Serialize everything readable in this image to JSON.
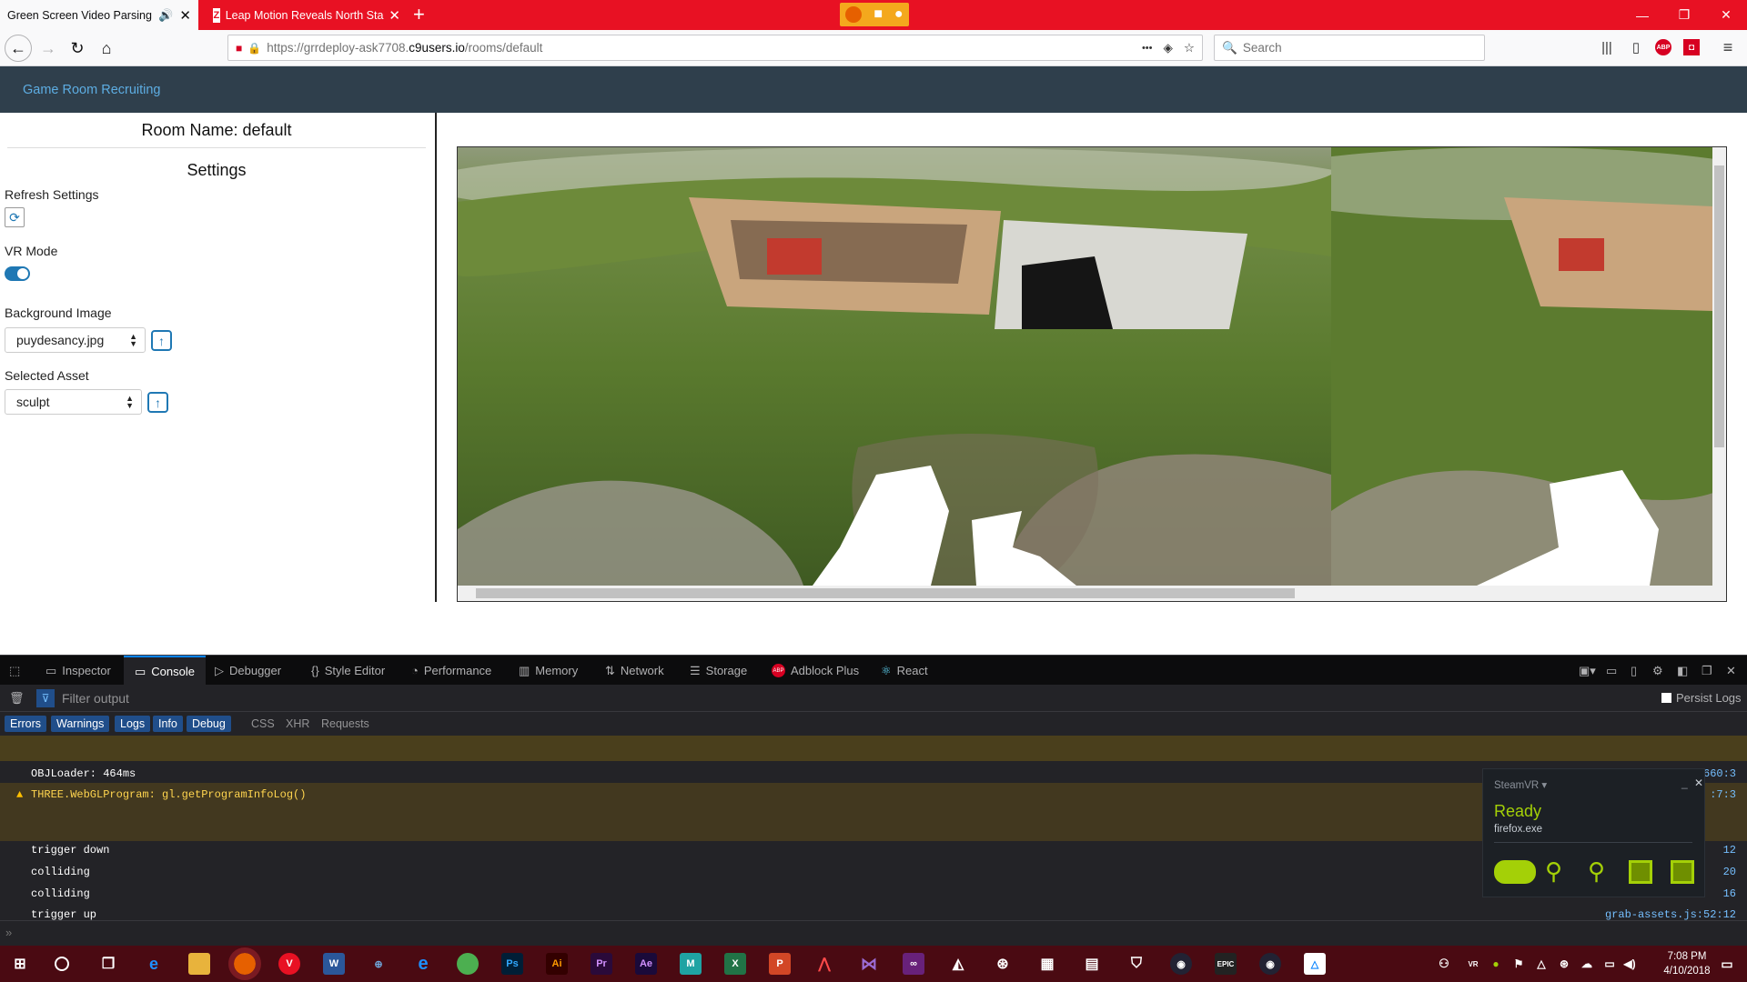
{
  "browser": {
    "tabs": [
      {
        "title": "Green Screen Video Parsing",
        "active": true
      },
      {
        "title": "Leap Motion Reveals North Sta",
        "active": false
      }
    ],
    "url_prefix": "https://grrdeploy-ask7708.",
    "url_domain": "c9users.io",
    "url_path": "/rooms/default",
    "search_placeholder": "Search",
    "new_tab": "+",
    "menu_dots": "•••"
  },
  "site": {
    "brand": "Game Room Recruiting"
  },
  "sidebar": {
    "room_title": "Room Name: default",
    "settings_heading": "Settings",
    "refresh_label": "Refresh Settings",
    "vr_label": "VR Mode",
    "vr_enabled": true,
    "bg_label": "Background Image",
    "bg_value": "puydesancy.jpg",
    "asset_label": "Selected Asset",
    "asset_value": "sculpt"
  },
  "devtools": {
    "tabs": [
      "Inspector",
      "Console",
      "Debugger",
      "Style Editor",
      "Performance",
      "Memory",
      "Network",
      "Storage",
      "Adblock Plus",
      "React"
    ],
    "active_tab": "Console",
    "filter_placeholder": "Filter output",
    "persist_logs": "Persist Logs",
    "categories_on": [
      "Errors",
      "Warnings",
      "Logs",
      "Info",
      "Debug"
    ],
    "categories_off": [
      "CSS",
      "XHR",
      "Requests"
    ],
    "messages": [
      {
        "text": "OBJLoader: 464ms",
        "source": "OBJLoader.js:660:3",
        "kind": "log"
      },
      {
        "text": "THREE.WebGLProgram: gl.getProgramInfoLog()",
        "source": ":7:3",
        "kind": "warn"
      },
      {
        "text": "trigger down",
        "source": "12",
        "kind": "log"
      },
      {
        "text": "colliding",
        "source": "20",
        "kind": "log"
      },
      {
        "text": "colliding",
        "source": "16",
        "kind": "log"
      },
      {
        "text": "trigger up",
        "source": "grab-assets.js:52:12",
        "kind": "log"
      }
    ]
  },
  "steamvr": {
    "title": "SteamVR ▾",
    "status": "Ready",
    "process": "firefox.exe"
  },
  "taskbar": {
    "time": "7:08 PM",
    "date": "4/10/2018"
  },
  "colors": {
    "titlebar": "#e81123",
    "site_header": "#2f3f4c",
    "accent": "#1f78b4",
    "steam_ready": "#a4d007"
  }
}
